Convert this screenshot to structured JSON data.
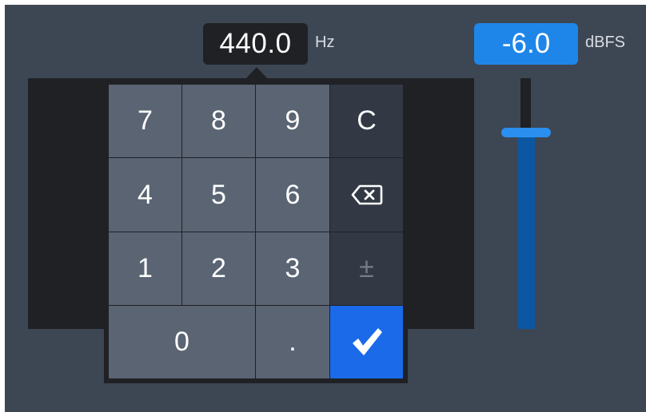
{
  "frequency": {
    "value": "440.0",
    "unit": "Hz"
  },
  "level": {
    "value": "-6.0",
    "unit": "dBFS",
    "slider_position": 0.78
  },
  "keypad": {
    "keys": {
      "k7": "7",
      "k8": "8",
      "k9": "9",
      "clear": "C",
      "k4": "4",
      "k5": "5",
      "k6": "6",
      "k1": "1",
      "k2": "2",
      "k3": "3",
      "sign": "±",
      "k0": "0",
      "decimal": "."
    },
    "icons": {
      "backspace": "backspace-icon",
      "confirm": "checkmark-icon"
    }
  },
  "colors": {
    "background": "#3d4653",
    "key": "#5a6473",
    "function_key": "#323844",
    "accent": "#1a6ae9",
    "level_display": "#1f86e9",
    "slider_fill": "#0c57a3",
    "panel": "#1f2124"
  }
}
